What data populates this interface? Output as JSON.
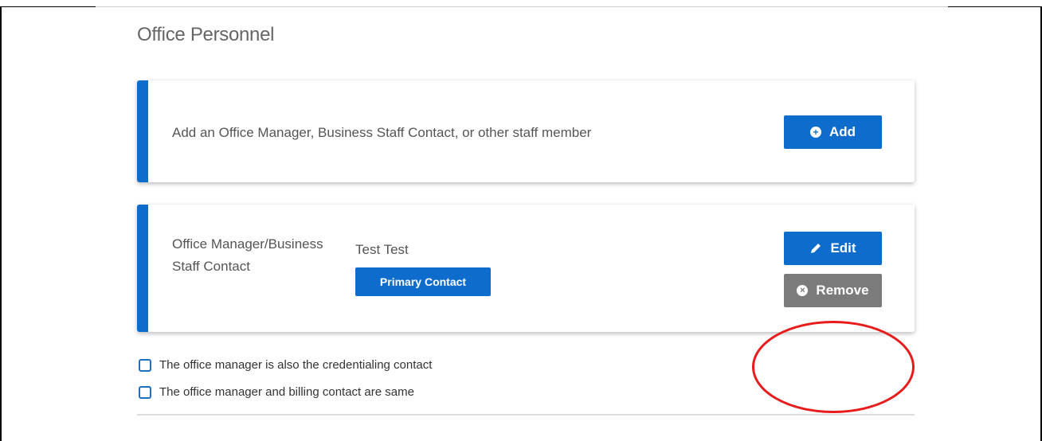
{
  "section": {
    "title": "Office Personnel"
  },
  "add_card": {
    "text": "Add an Office Manager, Business Staff Contact, or other staff member",
    "add_label": "Add",
    "add_icon": "plus-circle-icon"
  },
  "contact_card": {
    "role": "Office Manager/Business Staff Contact",
    "name": "Test Test",
    "badge": "Primary Contact",
    "edit_label": "Edit",
    "edit_icon": "pencil-icon",
    "remove_label": "Remove",
    "remove_icon": "x-circle-icon"
  },
  "checkboxes": [
    {
      "label": "The office manager is also the credentialing contact",
      "checked": false
    },
    {
      "label": "The office manager and billing contact are same",
      "checked": false
    }
  ],
  "colors": {
    "accent": "#0e6ccc",
    "remove_button": "#7b7b7b",
    "annotation": "#e81c1c"
  }
}
